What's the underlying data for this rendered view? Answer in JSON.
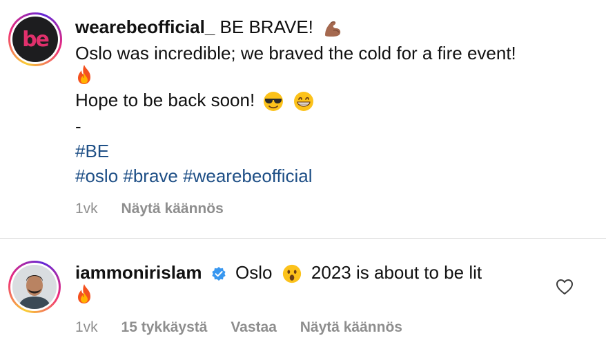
{
  "post": {
    "author": {
      "username": "wearebeofficial_",
      "avatar_logo_text": "be"
    },
    "caption_title": "BE BRAVE!",
    "caption_title_emoji": "flexed-biceps-emoji",
    "line1": "Oslo was incredible; we braved the cold for a fire event!",
    "line1_emoji": "fire-emoji",
    "line2": "Hope to be back soon!",
    "line2_emojis": [
      "sunglasses-face-emoji",
      "grinning-face-emoji"
    ],
    "separator": "-",
    "hashtag_line1": "#BE",
    "hashtags": [
      "#oslo",
      "#brave",
      "#wearebeofficial"
    ],
    "time": "1vk",
    "translate_label": "Näytä käännös"
  },
  "comment": {
    "username": "iammonirislam",
    "verified": true,
    "text_before_emoji": "Oslo",
    "emoji": "hushed-face-emoji",
    "text_after_emoji": "2023 is about to be lit",
    "trailing_emoji": "fire-emoji",
    "time": "1vk",
    "likes_label": "15 tykkäystä",
    "reply_label": "Vastaa",
    "translate_label": "Näytä käännös",
    "like_icon": "heart-outline-icon"
  },
  "colors": {
    "text": "#111111",
    "meta": "#8e8e8e",
    "hashtag": "#1e4f86",
    "verified": "#3897f0",
    "logo": "#e1306c"
  }
}
